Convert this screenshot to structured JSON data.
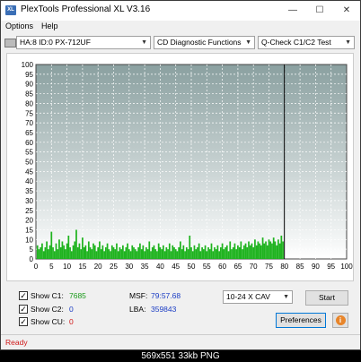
{
  "window": {
    "title": "PlexTools Professional XL V3.16",
    "icon_text": "XL",
    "minimize": "—",
    "maximize": "☐",
    "close": "✕"
  },
  "menu": {
    "options": "Options",
    "help": "Help"
  },
  "toolbar": {
    "drive": "HA:8 ID:0  PX-712UF",
    "function": "CD Diagnostic Functions",
    "test": "Q-Check C1/C2 Test"
  },
  "chart_data": {
    "type": "bar",
    "xlim": [
      0,
      100
    ],
    "ylim": [
      0,
      100
    ],
    "x_ticks": [
      0,
      5,
      10,
      15,
      20,
      25,
      30,
      35,
      40,
      45,
      50,
      55,
      60,
      65,
      70,
      75,
      80,
      85,
      90,
      95,
      100
    ],
    "y_ticks": [
      0,
      5,
      10,
      15,
      20,
      25,
      30,
      35,
      40,
      45,
      50,
      55,
      60,
      65,
      70,
      75,
      80,
      85,
      90,
      95,
      100
    ],
    "end_marker_x": 79.96,
    "grid": true,
    "series": [
      {
        "color": "#1fb31f",
        "x": [
          0.5,
          1,
          1.5,
          2,
          2.5,
          3,
          3.5,
          4,
          4.5,
          5,
          5.5,
          6,
          6.5,
          7,
          7.5,
          8,
          8.5,
          9,
          9.5,
          10,
          10.5,
          11,
          11.5,
          12,
          12.5,
          13,
          13.5,
          14,
          14.5,
          15,
          15.5,
          16,
          16.5,
          17,
          17.5,
          18,
          18.5,
          19,
          19.5,
          20,
          20.5,
          21,
          21.5,
          22,
          22.5,
          23,
          23.5,
          24,
          24.5,
          25,
          25.5,
          26,
          26.5,
          27,
          27.5,
          28,
          28.5,
          29,
          29.5,
          30,
          30.5,
          31,
          31.5,
          32,
          32.5,
          33,
          33.5,
          34,
          34.5,
          35,
          35.5,
          36,
          36.5,
          37,
          37.5,
          38,
          38.5,
          39,
          39.5,
          40,
          40.5,
          41,
          41.5,
          42,
          42.5,
          43,
          43.5,
          44,
          44.5,
          45,
          45.5,
          46,
          46.5,
          47,
          47.5,
          48,
          48.5,
          49,
          49.5,
          50,
          50.5,
          51,
          51.5,
          52,
          52.5,
          53,
          53.5,
          54,
          54.5,
          55,
          55.5,
          56,
          56.5,
          57,
          57.5,
          58,
          58.5,
          59,
          59.5,
          60,
          60.5,
          61,
          61.5,
          62,
          62.5,
          63,
          63.5,
          64,
          64.5,
          65,
          65.5,
          66,
          66.5,
          67,
          67.5,
          68,
          68.5,
          69,
          69.5,
          70,
          70.5,
          71,
          71.5,
          72,
          72.5,
          73,
          73.5,
          74,
          74.5,
          75,
          75.5,
          76,
          76.5,
          77,
          77.5,
          78,
          78.5,
          79,
          79.5
        ],
        "values": [
          7,
          5,
          6,
          8,
          4,
          6,
          9,
          5,
          7,
          14,
          6,
          4,
          8,
          5,
          10,
          6,
          9,
          7,
          5,
          8,
          12,
          6,
          4,
          7,
          9,
          15,
          6,
          8,
          5,
          11,
          6,
          7,
          4,
          9,
          6,
          5,
          8,
          7,
          4,
          6,
          9,
          5,
          7,
          4,
          6,
          8,
          5,
          4,
          7,
          6,
          5,
          8,
          4,
          6,
          5,
          7,
          4,
          6,
          8,
          5,
          4,
          7,
          6,
          5,
          4,
          6,
          8,
          5,
          7,
          4,
          6,
          5,
          9,
          4,
          6,
          7,
          5,
          4,
          8,
          6,
          5,
          7,
          4,
          6,
          5,
          8,
          4,
          7,
          6,
          5,
          4,
          6,
          9,
          5,
          7,
          4,
          6,
          5,
          12,
          6,
          4,
          7,
          5,
          6,
          8,
          4,
          6,
          5,
          7,
          4,
          6,
          5,
          8,
          4,
          6,
          5,
          7,
          4,
          6,
          8,
          5,
          6,
          7,
          4,
          9,
          5,
          6,
          8,
          5,
          7,
          6,
          9,
          5,
          7,
          8,
          6,
          9,
          7,
          8,
          6,
          10,
          7,
          9,
          8,
          7,
          11,
          8,
          9,
          7,
          10,
          9,
          8,
          11,
          9,
          7,
          10,
          8,
          12,
          9
        ]
      }
    ]
  },
  "stats": {
    "show_c1_label": "Show C1:",
    "c1_value": "7685",
    "show_c2_label": "Show C2:",
    "c2_value": "0",
    "show_cu_label": "Show CU:",
    "cu_value": "0",
    "msf_label": "MSF:",
    "msf_value": "79:57.68",
    "lba_label": "LBA:",
    "lba_value": "359843"
  },
  "controls": {
    "speed": "10-24 X CAV",
    "start_label": "Start",
    "preferences_label": "Preferences",
    "info_icon": "i"
  },
  "status": {
    "text": "Ready"
  },
  "caption": "569x551 33kb PNG",
  "colors": {
    "c1": "#1fb31f",
    "c1_text": "#1a9a1a",
    "c2_text": "#1a3cc4",
    "cu_text": "#d01818",
    "status_text": "#d01818",
    "plot_top": "#8aa0a0",
    "plot_bottom": "#ffffff"
  }
}
